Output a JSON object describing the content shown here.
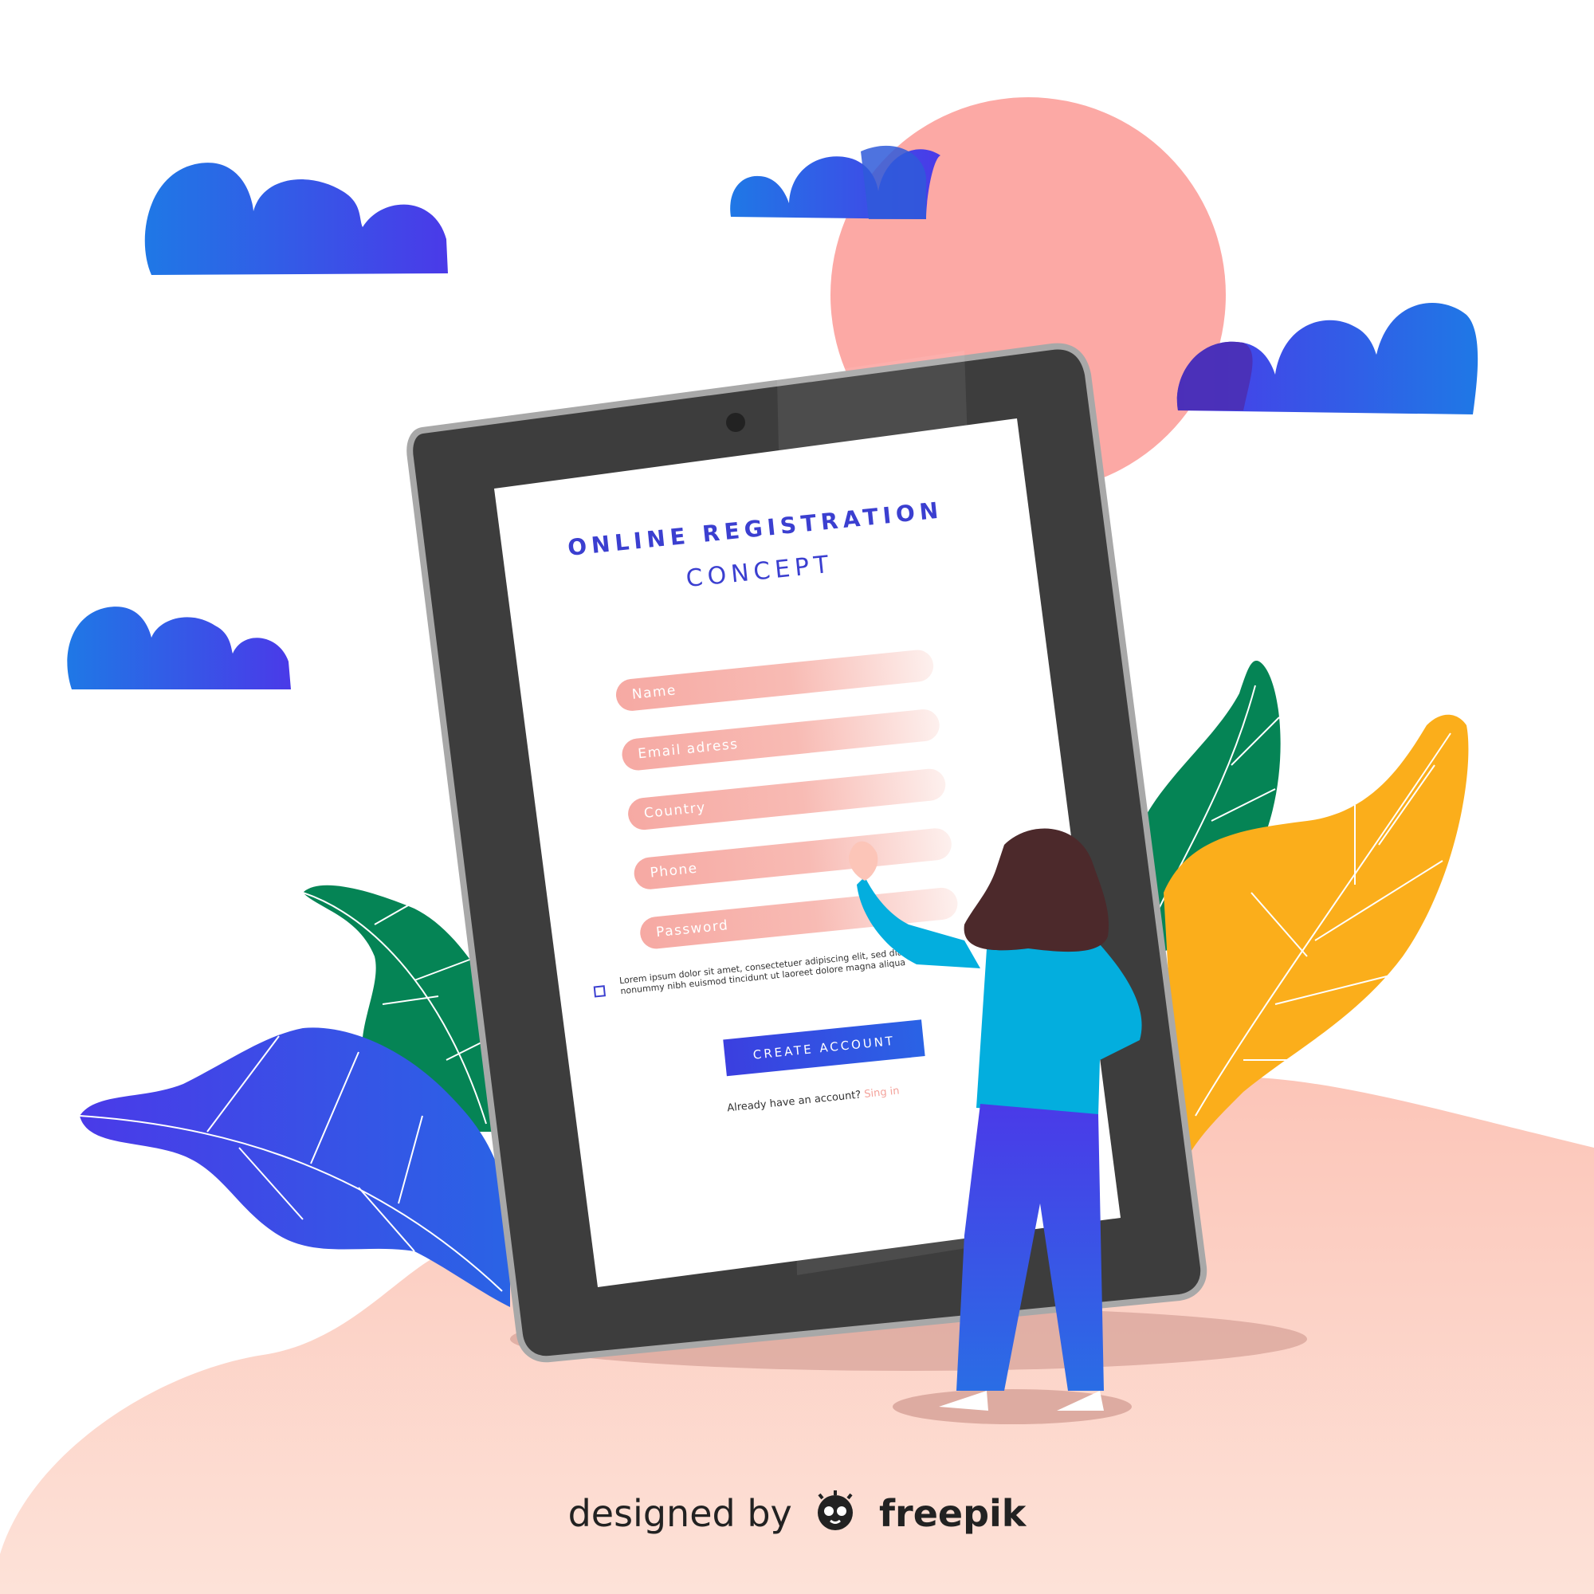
{
  "form": {
    "title": "ONLINE REGISTRATION",
    "subtitle": "CONCEPT",
    "fields": [
      {
        "placeholder": "Name"
      },
      {
        "placeholder": "Email adress"
      },
      {
        "placeholder": "Country"
      },
      {
        "placeholder": "Phone"
      },
      {
        "placeholder": "Password"
      }
    ],
    "terms_line1": "Lorem ipsum dolor sit amet, consectetuer adipiscing elit, sed diam",
    "terms_line2": "nonummy nibh euismod tincidunt ut laoreet dolore magna aliqua",
    "create_button": "CREATE ACCOUNT",
    "signin_prompt": "Already have an account?",
    "signin_link": "Sing in"
  },
  "credit": {
    "prefix": "designed by",
    "brand": "freepik"
  },
  "colors": {
    "accent_blue": "#3b3fd0",
    "field_pink": "#f6a9a3",
    "sun": "#fca9a5",
    "ground": "#fbd0c4",
    "leaf_green": "#058455",
    "leaf_yellow": "#fbae1b",
    "leaf_blue": "#3b4fe0",
    "tablet_frame": "#3d3d3d"
  }
}
